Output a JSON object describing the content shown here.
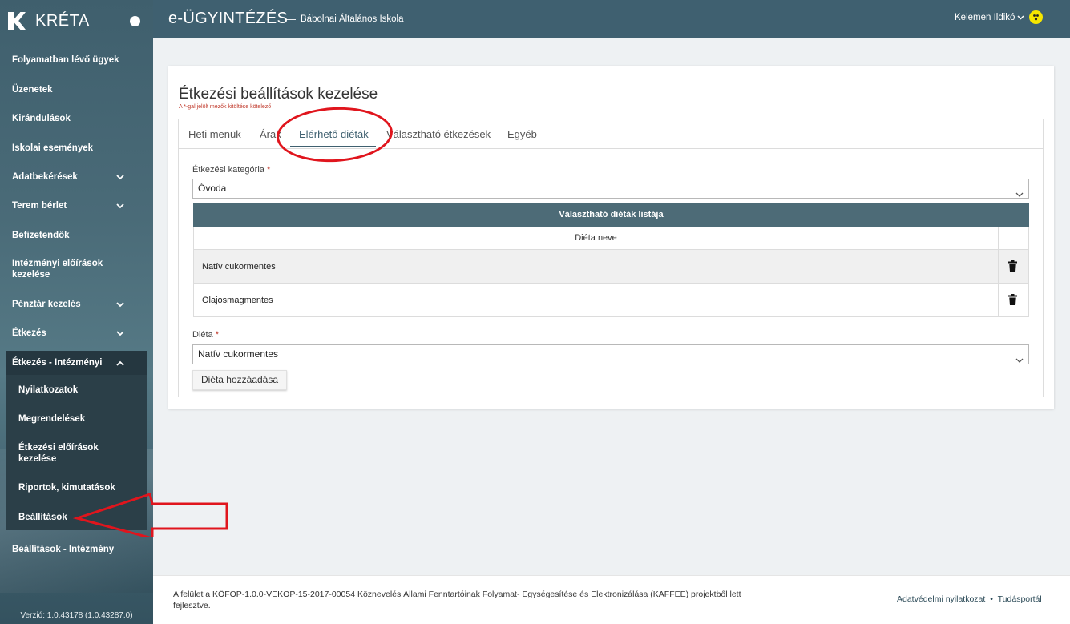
{
  "brand": {
    "name": "KRÉTA",
    "logo_letter": "K"
  },
  "sidebar": {
    "items": [
      {
        "label": "Folyamatban lévő ügyek",
        "chevron": ""
      },
      {
        "label": "Üzenetek",
        "chevron": ""
      },
      {
        "label": "Kirándulások",
        "chevron": ""
      },
      {
        "label": "Iskolai események",
        "chevron": ""
      },
      {
        "label": "Adatbekérések",
        "chevron": "down"
      },
      {
        "label": "Terem bérlet",
        "chevron": "down"
      },
      {
        "label": "Befizetendők",
        "chevron": ""
      },
      {
        "label": "Intézményi előírások kezelése",
        "chevron": ""
      },
      {
        "label": "Pénztár kezelés",
        "chevron": "down"
      },
      {
        "label": "Étkezés",
        "chevron": "down"
      },
      {
        "label": "Étkezés - Intézményi",
        "chevron": "up"
      },
      {
        "label": "Beállítások - Intézmény",
        "chevron": ""
      }
    ],
    "subitems": [
      {
        "label": "Nyilatkozatok"
      },
      {
        "label": "Megrendelések"
      },
      {
        "label": "Étkezési előírások kezelése"
      },
      {
        "label": "Riportok, kimutatások"
      },
      {
        "label": "Beállítások"
      }
    ],
    "version": "Verzió: 1.0.43178 (1.0.43287.0)"
  },
  "header": {
    "title": "e-ÜGYINTÉZÉS",
    "dash": "—",
    "school": "Bábolnai Általános Iskola",
    "user": "Kelemen Ildikó"
  },
  "page": {
    "title": "Étkezési beállítások kezelése",
    "required_note": "A *-gal jelölt mezők kitöltése kötelező",
    "tabs": [
      {
        "label": "Heti menük"
      },
      {
        "label": "Árak"
      },
      {
        "label": "Elérhető diéták"
      },
      {
        "label": "Választható étkezések"
      },
      {
        "label": "Egyéb"
      }
    ],
    "category": {
      "label": "Étkezési kategória",
      "required": "*",
      "value": "Óvoda"
    },
    "table": {
      "title": "Választható diéták listája",
      "column_name": "Diéta neve",
      "rows": [
        {
          "name": "Natív cukormentes"
        },
        {
          "name": "Olajosmagmentes"
        }
      ]
    },
    "diet": {
      "label": "Diéta",
      "required": "*",
      "value": "Natív cukormentes"
    },
    "add_button": "Diéta hozzáadása"
  },
  "footer": {
    "text": "A felület a KÖFOP-1.0.0-VEKOP-15-2017-00054 Köznevelés Állami Fenntartóinak Folyamat- Egységesítése és Elektronizálása (KAFFEE) projektből lett fejlesztve.",
    "privacy": "Adatvédelmi nyilatkozat",
    "separator": "•",
    "knowledge": "Tudásportál"
  },
  "colors": {
    "header": "#3f6070",
    "accent": "#e0151d",
    "table_head": "#4d6b77"
  }
}
